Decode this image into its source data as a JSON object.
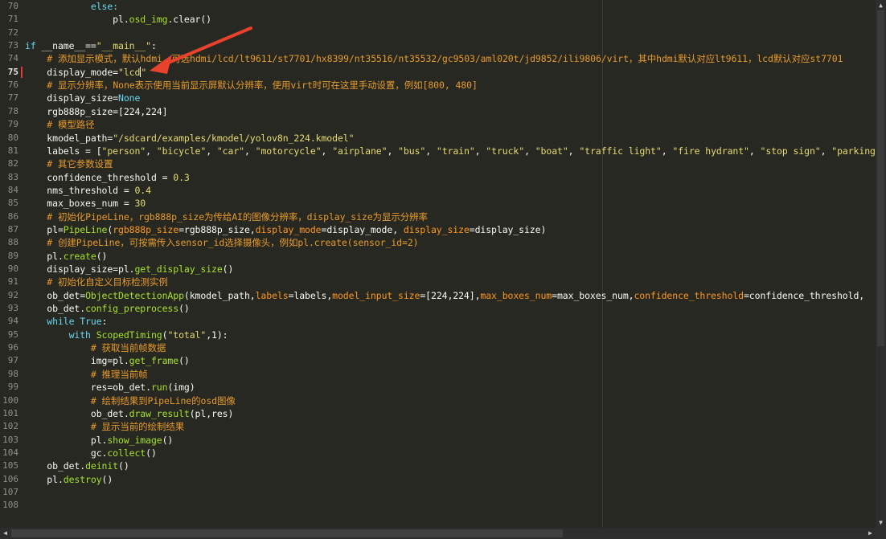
{
  "editor": {
    "current_line": 75,
    "lines": [
      {
        "n": "70",
        "t": [
          [
            "kw",
            "            else:"
          ]
        ]
      },
      {
        "n": "71",
        "t": [
          [
            "",
            "                pl."
          ],
          [
            "fn",
            "osd_img"
          ],
          [
            "",
            ".clear()"
          ]
        ]
      },
      {
        "n": "72",
        "t": []
      },
      {
        "n": "73",
        "t": [
          [
            "kw",
            "if"
          ],
          [
            "",
            " __name__=="
          ],
          [
            "st",
            "\"__main__\""
          ],
          [
            "",
            ":"
          ]
        ]
      },
      {
        "n": "74",
        "t": [
          [
            "cm",
            "    # 添加显示模式，默认hdmi，可选hdmi/lcd/lt9611/st7701/hx8399/nt35516/nt35532/gc9503/aml020t/jd9852/ili9806/virt，其中hdmi默认对应lt9611，lcd默认对应st7701"
          ]
        ]
      },
      {
        "n": "75",
        "t": [
          [
            "",
            "    display_mode="
          ],
          [
            "st",
            "\"lcd\""
          ]
        ]
      },
      {
        "n": "76",
        "t": [
          [
            "cm",
            "    # 显示分辨率，None表示使用当前显示屏默认分辨率，使用virt时可在这里手动设置，例如[800, 480]"
          ]
        ]
      },
      {
        "n": "77",
        "t": [
          [
            "",
            "    display_size="
          ],
          [
            "kw",
            "None"
          ]
        ]
      },
      {
        "n": "78",
        "t": [
          [
            "",
            "    rgb888p_size=[224,224]"
          ]
        ]
      },
      {
        "n": "79",
        "t": [
          [
            "cm",
            "    # 模型路径"
          ]
        ]
      },
      {
        "n": "80",
        "t": [
          [
            "",
            "    kmodel_path="
          ],
          [
            "st",
            "\"/sdcard/examples/kmodel/yolov8n_224.kmodel\""
          ]
        ]
      },
      {
        "n": "81",
        "t": [
          [
            "",
            "    labels = ["
          ],
          [
            "st",
            "\"person\""
          ],
          [
            "",
            ", "
          ],
          [
            "st",
            "\"bicycle\""
          ],
          [
            "",
            ", "
          ],
          [
            "st",
            "\"car\""
          ],
          [
            "",
            ", "
          ],
          [
            "st",
            "\"motorcycle\""
          ],
          [
            "",
            ", "
          ],
          [
            "st",
            "\"airplane\""
          ],
          [
            "",
            ", "
          ],
          [
            "st",
            "\"bus\""
          ],
          [
            "",
            ", "
          ],
          [
            "st",
            "\"train\""
          ],
          [
            "",
            ", "
          ],
          [
            "st",
            "\"truck\""
          ],
          [
            "",
            ", "
          ],
          [
            "st",
            "\"boat\""
          ],
          [
            "",
            ", "
          ],
          [
            "st",
            "\"traffic light\""
          ],
          [
            "",
            ", "
          ],
          [
            "st",
            "\"fire hydrant\""
          ],
          [
            "",
            ", "
          ],
          [
            "st",
            "\"stop sign\""
          ],
          [
            "",
            ", "
          ],
          [
            "st",
            "\"parking meter\""
          ]
        ]
      },
      {
        "n": "82",
        "t": [
          [
            "cm",
            "    # 其它参数设置"
          ]
        ]
      },
      {
        "n": "83",
        "t": [
          [
            "",
            "    confidence_threshold = "
          ],
          [
            "st",
            "0.3"
          ]
        ]
      },
      {
        "n": "84",
        "t": [
          [
            "",
            "    nms_threshold = "
          ],
          [
            "st",
            "0.4"
          ]
        ]
      },
      {
        "n": "85",
        "t": [
          [
            "",
            "    max_boxes_num = "
          ],
          [
            "st",
            "30"
          ]
        ]
      },
      {
        "n": "86",
        "t": [
          [
            "cm",
            "    # 初始化PipeLine，rgb888p_size为传给AI的图像分辨率，display_size为显示分辨率"
          ]
        ]
      },
      {
        "n": "87",
        "t": [
          [
            "",
            "    pl="
          ],
          [
            "fn",
            "PipeLine"
          ],
          [
            "",
            "("
          ],
          [
            "pm",
            "rgb888p_size"
          ],
          [
            "",
            "=rgb888p_size,"
          ],
          [
            "pm",
            "display_mode"
          ],
          [
            "",
            "=display_mode, "
          ],
          [
            "pm",
            "display_size"
          ],
          [
            "",
            "=display_size)"
          ]
        ]
      },
      {
        "n": "88",
        "t": [
          [
            "cm",
            "    # 创建PipeLine，可按需传入sensor_id选择摄像头，例如pl.create(sensor_id=2)"
          ]
        ]
      },
      {
        "n": "89",
        "t": [
          [
            "",
            "    pl."
          ],
          [
            "fn",
            "create"
          ],
          [
            "",
            "()"
          ]
        ]
      },
      {
        "n": "90",
        "t": [
          [
            "",
            "    display_size=pl."
          ],
          [
            "fn",
            "get_display_size"
          ],
          [
            "",
            "()"
          ]
        ]
      },
      {
        "n": "91",
        "t": [
          [
            "cm",
            "    # 初始化自定义目标检测实例"
          ]
        ]
      },
      {
        "n": "92",
        "t": [
          [
            "",
            "    ob_det="
          ],
          [
            "fn",
            "ObjectDetectionApp"
          ],
          [
            "",
            "(kmodel_path,"
          ],
          [
            "pm",
            "labels"
          ],
          [
            "",
            "=labels,"
          ],
          [
            "pm",
            "model_input_size"
          ],
          [
            "",
            "=[224,224],"
          ],
          [
            "pm",
            "max_boxes_num"
          ],
          [
            "",
            "=max_boxes_num,"
          ],
          [
            "pm",
            "confidence_threshold"
          ],
          [
            "",
            "=confidence_threshold,"
          ]
        ]
      },
      {
        "n": "93",
        "t": [
          [
            "",
            "    ob_det."
          ],
          [
            "fn",
            "config_preprocess"
          ],
          [
            "",
            "()"
          ]
        ]
      },
      {
        "n": "94",
        "t": [
          [
            "kw",
            "    while True"
          ],
          [
            "",
            ":"
          ]
        ]
      },
      {
        "n": "95",
        "t": [
          [
            "kw",
            "        with "
          ],
          [
            "fn",
            "ScopedTiming"
          ],
          [
            "",
            "("
          ],
          [
            "st",
            "\"total\""
          ],
          [
            "",
            ",1):"
          ]
        ]
      },
      {
        "n": "96",
        "t": [
          [
            "cm",
            "            # 获取当前帧数据"
          ]
        ]
      },
      {
        "n": "97",
        "t": [
          [
            "",
            "            img=pl."
          ],
          [
            "fn",
            "get_frame"
          ],
          [
            "",
            "()"
          ]
        ]
      },
      {
        "n": "98",
        "t": [
          [
            "cm",
            "            # 推理当前帧"
          ]
        ]
      },
      {
        "n": "99",
        "t": [
          [
            "",
            "            res=ob_det."
          ],
          [
            "fn",
            "run"
          ],
          [
            "",
            "(img)"
          ]
        ]
      },
      {
        "n": "100",
        "t": [
          [
            "cm",
            "            # 绘制结果到PipeLine的osd图像"
          ]
        ]
      },
      {
        "n": "101",
        "t": [
          [
            "",
            "            ob_det."
          ],
          [
            "fn",
            "draw_result"
          ],
          [
            "",
            "(pl,res)"
          ]
        ]
      },
      {
        "n": "102",
        "t": [
          [
            "cm",
            "            # 显示当前的绘制结果"
          ]
        ]
      },
      {
        "n": "103",
        "t": [
          [
            "",
            "            pl."
          ],
          [
            "fn",
            "show_image"
          ],
          [
            "",
            "()"
          ]
        ]
      },
      {
        "n": "104",
        "t": [
          [
            "",
            "            gc."
          ],
          [
            "fn",
            "collect"
          ],
          [
            "",
            "()"
          ]
        ]
      },
      {
        "n": "105",
        "t": [
          [
            "",
            "    ob_det."
          ],
          [
            "fn",
            "deinit"
          ],
          [
            "",
            "()"
          ]
        ]
      },
      {
        "n": "106",
        "t": [
          [
            "",
            "    pl."
          ],
          [
            "fn",
            "destroy"
          ],
          [
            "",
            "()"
          ]
        ]
      },
      {
        "n": "107",
        "t": []
      },
      {
        "n": "108",
        "t": []
      }
    ]
  },
  "scrollbars": {
    "vertical_position": 0.0,
    "horizontal_position": 0.0,
    "up_icon": "triangle-up-icon",
    "down_icon": "triangle-down-icon",
    "left_icon": "triangle-left-icon",
    "right_icon": "triangle-right-icon"
  },
  "annotation": {
    "type": "red-arrow",
    "color": "#e8412c",
    "points_to_line": 75
  },
  "colors": {
    "background": "#272822",
    "keyword": "#66d9ef",
    "function": "#a6e22e",
    "string": "#e6db74",
    "comment": "#e69a2e",
    "parameter": "#fd971f"
  }
}
